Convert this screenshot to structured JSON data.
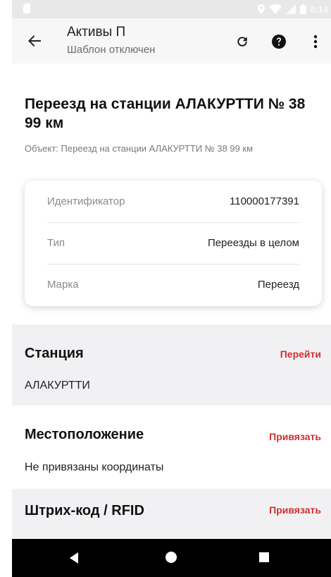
{
  "status_bar": {
    "time": "8:14"
  },
  "app_bar": {
    "title": "Активы П",
    "subtitle": "Шаблон отключен",
    "icons": {
      "back": "arrow-back",
      "refresh": "refresh",
      "help": "help",
      "more": "more-vert"
    }
  },
  "object": {
    "title": "Переезд на станции АЛАКУРТТИ № 38 99 км",
    "subtitle": "Объект: Переезд на станции АЛАКУРТТИ № 38 99 км"
  },
  "info": [
    {
      "label": "Идентификатор",
      "value": "110000177391"
    },
    {
      "label": "Тип",
      "value": "Переезды в целом"
    },
    {
      "label": "Марка",
      "value": "Переезд"
    }
  ],
  "station": {
    "title": "Станция",
    "action": "Перейти",
    "value": "АЛАКУРТТИ"
  },
  "location": {
    "title": "Местоположение",
    "action": "Привязать",
    "value": "Не привязаны координаты"
  },
  "barcode": {
    "title": "Штрих-код / RFID",
    "action": "Привязать"
  },
  "colors": {
    "accent": "#d32f2f",
    "section_bg": "#f1f1f3",
    "nav_bg": "#000000"
  }
}
